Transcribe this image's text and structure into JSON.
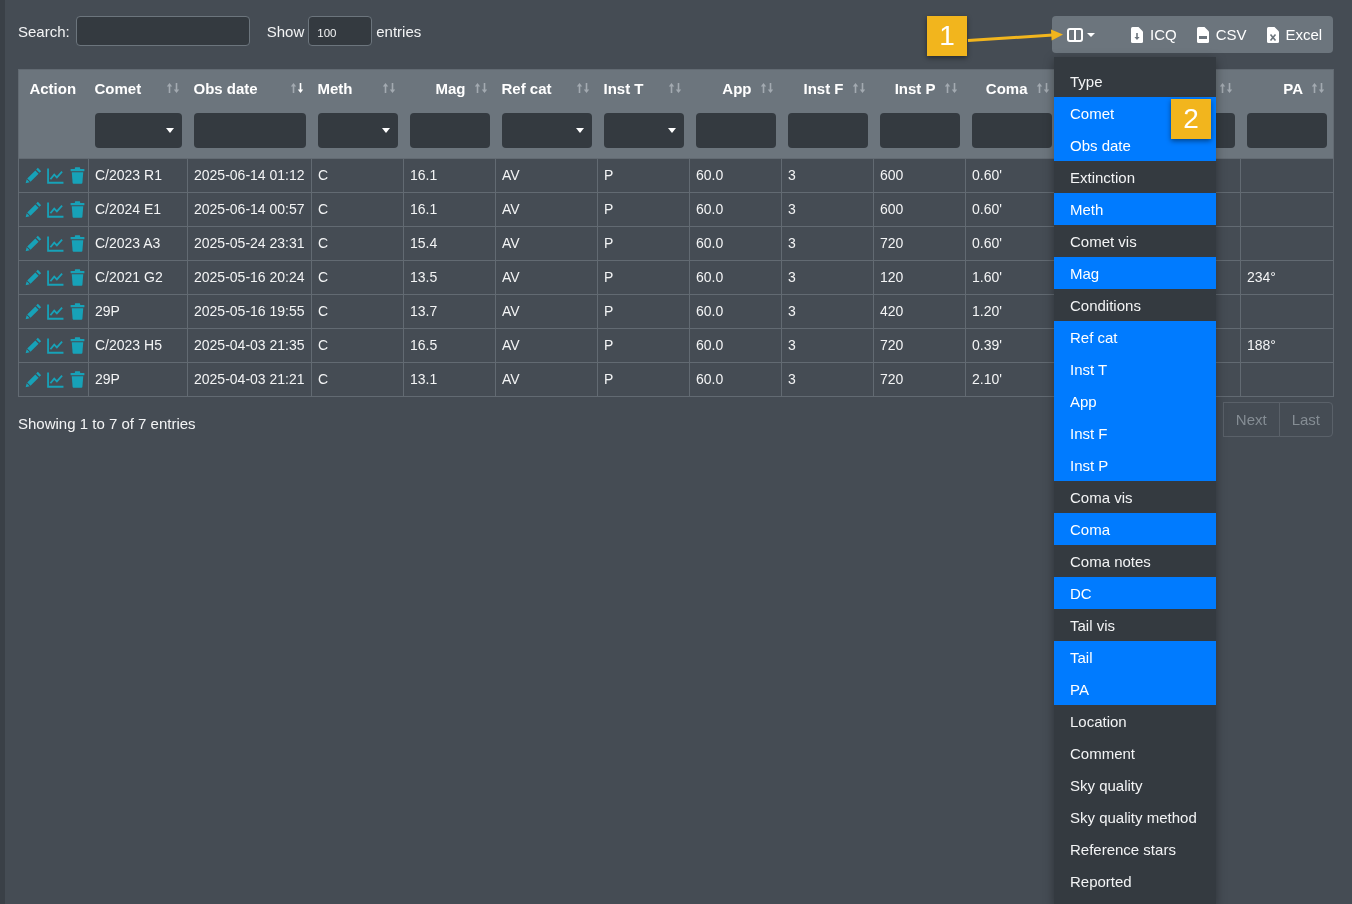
{
  "search": {
    "label": "Search:"
  },
  "page_length": {
    "label_before": "Show",
    "value": "100",
    "label_after": "entries"
  },
  "toolbar": {
    "buttons": [
      {
        "kind": "columns",
        "expanded": true,
        "menu": [
          {
            "label": "Type",
            "selected": false
          },
          {
            "label": "Comet",
            "selected": true
          },
          {
            "label": "Obs date",
            "selected": true
          },
          {
            "label": "Extinction",
            "selected": false
          },
          {
            "label": "Meth",
            "selected": true
          },
          {
            "label": "Comet vis",
            "selected": false
          },
          {
            "label": "Mag",
            "selected": true
          },
          {
            "label": "Conditions",
            "selected": false
          },
          {
            "label": "Ref cat",
            "selected": true
          },
          {
            "label": "Inst T",
            "selected": true
          },
          {
            "label": "App",
            "selected": true
          },
          {
            "label": "Inst F",
            "selected": true
          },
          {
            "label": "Inst P",
            "selected": true
          },
          {
            "label": "Coma vis",
            "selected": false
          },
          {
            "label": "Coma",
            "selected": true
          },
          {
            "label": "Coma notes",
            "selected": false
          },
          {
            "label": "DC",
            "selected": true
          },
          {
            "label": "Tail vis",
            "selected": false
          },
          {
            "label": "Tail",
            "selected": true
          },
          {
            "label": "PA",
            "selected": true
          },
          {
            "label": "Location",
            "selected": false
          },
          {
            "label": "Comment",
            "selected": false
          },
          {
            "label": "Sky quality",
            "selected": false
          },
          {
            "label": "Sky quality method",
            "selected": false
          },
          {
            "label": "Reference stars",
            "selected": false
          },
          {
            "label": "Reported",
            "selected": false
          }
        ]
      },
      {
        "kind": "download",
        "label": "ICQ"
      },
      {
        "kind": "csv",
        "label": "CSV"
      },
      {
        "kind": "excel",
        "label": "Excel"
      }
    ]
  },
  "table": {
    "columns": [
      {
        "kind": "actions",
        "label": "Action"
      },
      {
        "kind": "text",
        "label": "Comet",
        "sorted": false,
        "filter": {
          "kind": "select"
        }
      },
      {
        "kind": "text",
        "label": "Obs date",
        "sorted": true,
        "filter": {
          "kind": "text"
        }
      },
      {
        "kind": "text",
        "label": "Meth",
        "sorted": false,
        "filter": {
          "kind": "select"
        }
      },
      {
        "kind": "number",
        "label": "Mag",
        "sorted": false,
        "filter": {
          "kind": "text"
        }
      },
      {
        "kind": "text",
        "label": "Ref cat",
        "sorted": false,
        "filter": {
          "kind": "select"
        }
      },
      {
        "kind": "text",
        "label": "Inst T",
        "sorted": false,
        "filter": {
          "kind": "select"
        }
      },
      {
        "kind": "number",
        "label": "App",
        "sorted": false,
        "filter": {
          "kind": "text"
        }
      },
      {
        "kind": "number",
        "label": "Inst F",
        "sorted": false,
        "filter": {
          "kind": "text"
        }
      },
      {
        "kind": "number",
        "label": "Inst P",
        "sorted": false,
        "filter": {
          "kind": "text"
        }
      },
      {
        "kind": "number",
        "label": "Coma",
        "sorted": false,
        "filter": {
          "kind": "text"
        }
      },
      {
        "sorted": false,
        "filter": {
          "kind": "text"
        }
      },
      {
        "kind": "number",
        "label": "PA",
        "sorted": false,
        "filter": {
          "kind": "text"
        }
      }
    ],
    "rows": [
      {
        "cells": [
          "",
          "C/2023 R1",
          "2025-06-14 01:12",
          "C",
          "16.1",
          "AV",
          "P",
          "60.0",
          "3",
          "600",
          "0.60'"
        ]
      },
      {
        "cells": [
          "",
          "C/2024 E1",
          "2025-06-14 00:57",
          "C",
          "16.1",
          "AV",
          "P",
          "60.0",
          "3",
          "600",
          "0.60'"
        ]
      },
      {
        "cells": [
          "",
          "C/2023 A3",
          "2025-05-24 23:31",
          "C",
          "15.4",
          "AV",
          "P",
          "60.0",
          "3",
          "720",
          "0.60'"
        ]
      },
      {
        "cells": [
          "",
          "C/2021 G2",
          "2025-05-16 20:24",
          "C",
          "13.5",
          "AV",
          "P",
          "60.0",
          "3",
          "120",
          "1.60'",
          "",
          "234°"
        ]
      },
      {
        "cells": [
          "",
          "29P",
          "2025-05-16 19:55",
          "C",
          "13.7",
          "AV",
          "P",
          "60.0",
          "3",
          "420",
          "1.20'"
        ]
      },
      {
        "cells": [
          "",
          "C/2023 H5",
          "2025-04-03 21:35",
          "C",
          "16.5",
          "AV",
          "P",
          "60.0",
          "3",
          "720",
          "0.39'",
          "",
          "188°"
        ]
      },
      {
        "cells": [
          "",
          "29P",
          "2025-04-03 21:21",
          "C",
          "13.1",
          "AV",
          "P",
          "60.0",
          "3",
          "720",
          "2.10'"
        ]
      }
    ]
  },
  "info": "Showing 1 to 7 of 7 entries",
  "pagination": [
    {
      "label": "Next",
      "disabled": true
    },
    {
      "label": "Last",
      "disabled": true
    }
  ],
  "callouts": [
    {
      "label": "1",
      "kind": "arrow"
    },
    {
      "label": "2",
      "kind": "plain"
    }
  ]
}
